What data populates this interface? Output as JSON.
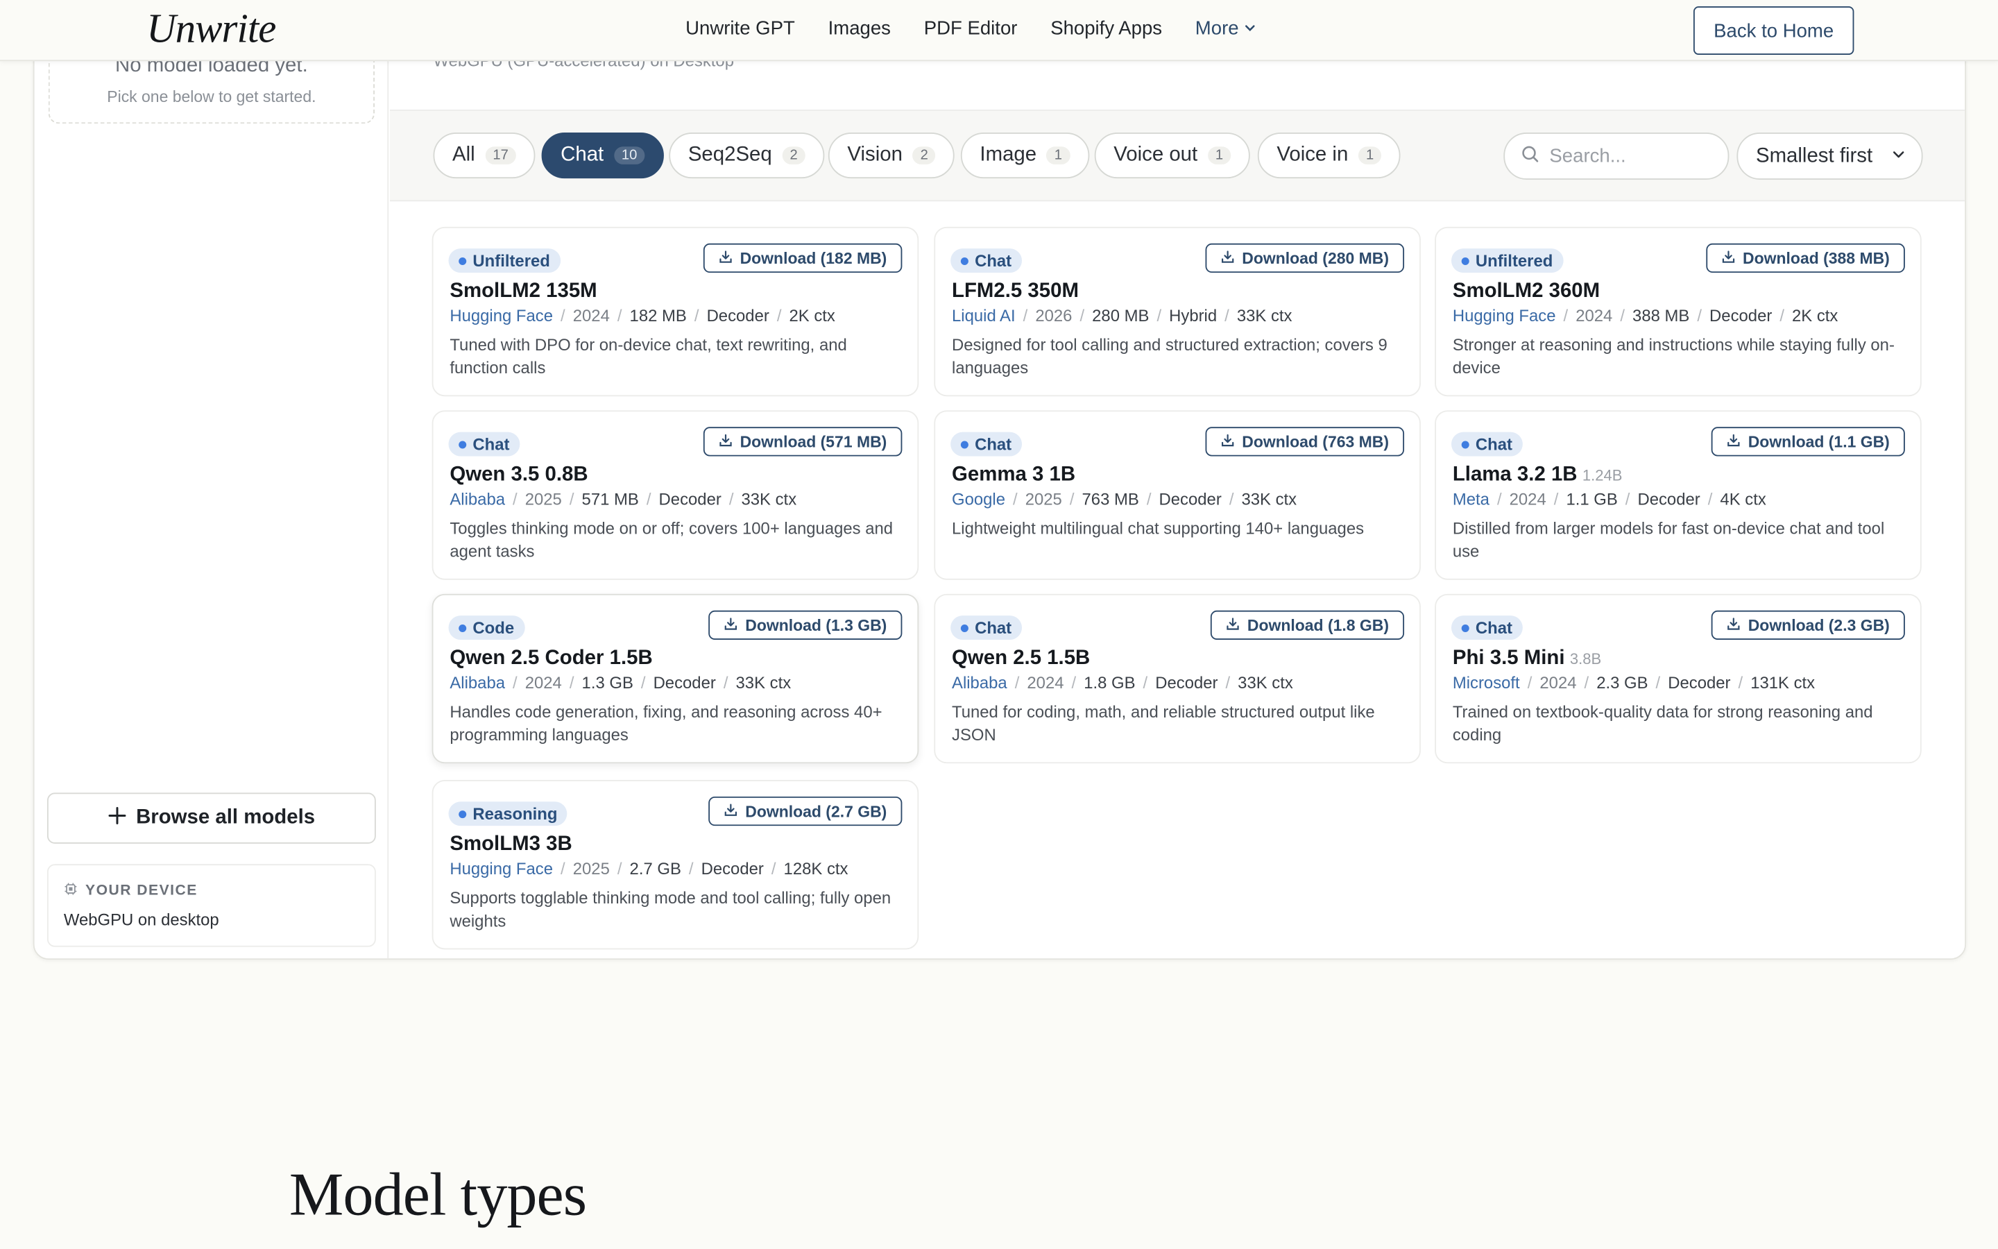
{
  "header": {
    "logo": "Unwrite",
    "nav": [
      "Unwrite GPT",
      "Images",
      "PDF Editor",
      "Shopify Apps"
    ],
    "more_label": "More",
    "back_label": "Back to Home"
  },
  "sidebar": {
    "no_model_title": "No model loaded yet.",
    "no_model_sub": "Pick one below to get started.",
    "browse_label": "Browse all models",
    "device_label": "YOUR DEVICE",
    "device_value": "WebGPU on desktop"
  },
  "webgpu_note": "WebGPU (GPU-accelerated) on Desktop",
  "filters": [
    {
      "label": "All",
      "count": "17",
      "active": false
    },
    {
      "label": "Chat",
      "count": "10",
      "active": true
    },
    {
      "label": "Seq2Seq",
      "count": "2",
      "active": false
    },
    {
      "label": "Vision",
      "count": "2",
      "active": false
    },
    {
      "label": "Image",
      "count": "1",
      "active": false
    },
    {
      "label": "Voice out",
      "count": "1",
      "active": false
    },
    {
      "label": "Voice in",
      "count": "1",
      "active": false
    }
  ],
  "search": {
    "placeholder": "Search..."
  },
  "sort": {
    "selected": "Smallest first"
  },
  "models": [
    {
      "tag": "Unfiltered",
      "download": "Download (182 MB)",
      "name": "SmolLM2 135M",
      "params": "",
      "org": "Hugging Face",
      "year": "2024",
      "size": "182 MB",
      "arch": "Decoder",
      "ctx": "2K ctx",
      "desc": "Tuned with DPO for on-device chat, text rewriting, and function calls"
    },
    {
      "tag": "Chat",
      "download": "Download (280 MB)",
      "name": "LFM2.5 350M",
      "params": "",
      "org": "Liquid AI",
      "year": "2026",
      "size": "280 MB",
      "arch": "Hybrid",
      "ctx": "33K ctx",
      "desc": "Designed for tool calling and structured extraction; covers 9 languages"
    },
    {
      "tag": "Unfiltered",
      "download": "Download (388 MB)",
      "name": "SmolLM2 360M",
      "params": "",
      "org": "Hugging Face",
      "year": "2024",
      "size": "388 MB",
      "arch": "Decoder",
      "ctx": "2K ctx",
      "desc": "Stronger at reasoning and instructions while staying fully on-device"
    },
    {
      "tag": "Chat",
      "download": "Download (571 MB)",
      "name": "Qwen 3.5 0.8B",
      "params": "",
      "org": "Alibaba",
      "year": "2025",
      "size": "571 MB",
      "arch": "Decoder",
      "ctx": "33K ctx",
      "desc": "Toggles thinking mode on or off; covers 100+ languages and agent tasks"
    },
    {
      "tag": "Chat",
      "download": "Download (763 MB)",
      "name": "Gemma 3 1B",
      "params": "",
      "org": "Google",
      "year": "2025",
      "size": "763 MB",
      "arch": "Decoder",
      "ctx": "33K ctx",
      "desc": "Lightweight multilingual chat supporting 140+ languages"
    },
    {
      "tag": "Chat",
      "download": "Download (1.1 GB)",
      "name": "Llama 3.2 1B",
      "params": "1.24B",
      "org": "Meta",
      "year": "2024",
      "size": "1.1 GB",
      "arch": "Decoder",
      "ctx": "4K ctx",
      "desc": "Distilled from larger models for fast on-device chat and tool use"
    },
    {
      "tag": "Code",
      "download": "Download (1.3 GB)",
      "name": "Qwen 2.5 Coder 1.5B",
      "params": "",
      "org": "Alibaba",
      "year": "2024",
      "size": "1.3 GB",
      "arch": "Decoder",
      "ctx": "33K ctx",
      "desc": "Handles code generation, fixing, and reasoning across 40+ programming languages"
    },
    {
      "tag": "Chat",
      "download": "Download (1.8 GB)",
      "name": "Qwen 2.5 1.5B",
      "params": "",
      "org": "Alibaba",
      "year": "2024",
      "size": "1.8 GB",
      "arch": "Decoder",
      "ctx": "33K ctx",
      "desc": "Tuned for coding, math, and reliable structured output like JSON"
    },
    {
      "tag": "Chat",
      "download": "Download (2.3 GB)",
      "name": "Phi 3.5 Mini",
      "params": "3.8B",
      "org": "Microsoft",
      "year": "2024",
      "size": "2.3 GB",
      "arch": "Decoder",
      "ctx": "131K ctx",
      "desc": "Trained on textbook-quality data for strong reasoning and coding"
    },
    {
      "tag": "Reasoning",
      "download": "Download (2.7 GB)",
      "name": "SmolLM3 3B",
      "params": "",
      "org": "Hugging Face",
      "year": "2025",
      "size": "2.7 GB",
      "arch": "Decoder",
      "ctx": "128K ctx",
      "desc": "Supports togglable thinking mode and tool calling; fully open weights"
    }
  ],
  "section_title": "Model types",
  "colors": {
    "accent": "#2c4a6e",
    "tag_bg": "#e2ebf7",
    "tag_dot": "#3f7de0",
    "background": "#fbfbf7"
  }
}
